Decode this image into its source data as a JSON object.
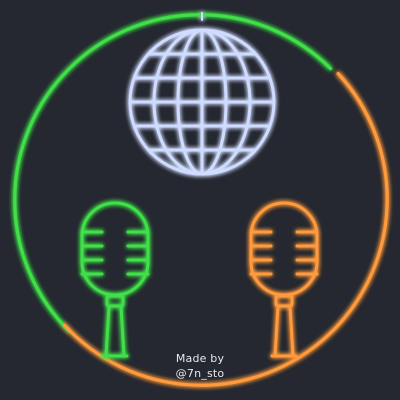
{
  "credit": {
    "line1": "Made by",
    "line2": "@7n_sto"
  },
  "icons": {
    "ring": "neon-ring",
    "globe": "disco-globe-icon",
    "left_mic": "microphone-icon",
    "right_mic": "microphone-icon"
  },
  "colors": {
    "background": "#252830",
    "green": "#3fe04a",
    "orange": "#ff9a3c",
    "globe": "#cfdcff",
    "text": "#e6e8ec"
  }
}
